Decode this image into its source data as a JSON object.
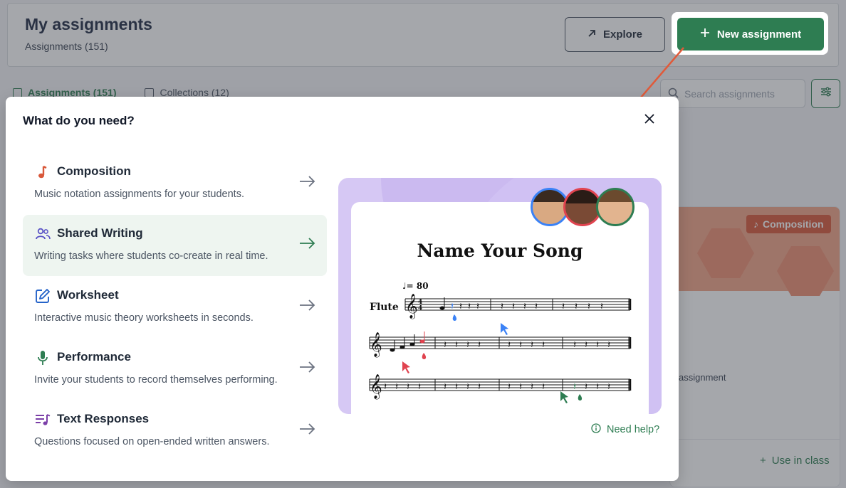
{
  "page": {
    "title": "My assignments",
    "subtitle": "Assignments (151)",
    "explore_label": "Explore",
    "new_assignment_label": "New assignment",
    "tabs": [
      {
        "label": "Assignments (151)",
        "active": true
      },
      {
        "label": "Collections (12)",
        "active": false
      }
    ],
    "search_placeholder": "Search assignments",
    "card": {
      "badge": "Composition",
      "partial_text": "assignment",
      "use_in_class": "Use in class"
    }
  },
  "modal": {
    "title": "What do you need?",
    "options": [
      {
        "title": "Composition",
        "description": "Music notation assignments for your students.",
        "icon": "music-note-icon",
        "color": "#d9583a"
      },
      {
        "title": "Shared Writing",
        "description": "Writing tasks where students co-create in real time.",
        "icon": "people-icon",
        "color": "#5b54c6",
        "selected": true
      },
      {
        "title": "Worksheet",
        "description": "Interactive music theory worksheets in seconds.",
        "icon": "edit-icon",
        "color": "#2563c9"
      },
      {
        "title": "Performance",
        "description": "Invite your students to record themselves performing.",
        "icon": "microphone-icon",
        "color": "#2e7d52"
      },
      {
        "title": "Text Responses",
        "description": "Questions focused on open-ended written answers.",
        "icon": "text-lines-music-icon",
        "color": "#7b3fa8"
      }
    ],
    "preview": {
      "song_title": "Name Your Song",
      "tempo": "♩= 80",
      "instrument": "Flute",
      "time_signature": [
        "4",
        "4"
      ]
    },
    "help_label": "Need help?"
  },
  "colors": {
    "primary_green": "#2e7d52",
    "annotation_red": "#e05a3a",
    "preview_purple": "#d6c8f4",
    "avatar_borders": [
      "#3b82f6",
      "#e0434f",
      "#2e7d52"
    ]
  }
}
